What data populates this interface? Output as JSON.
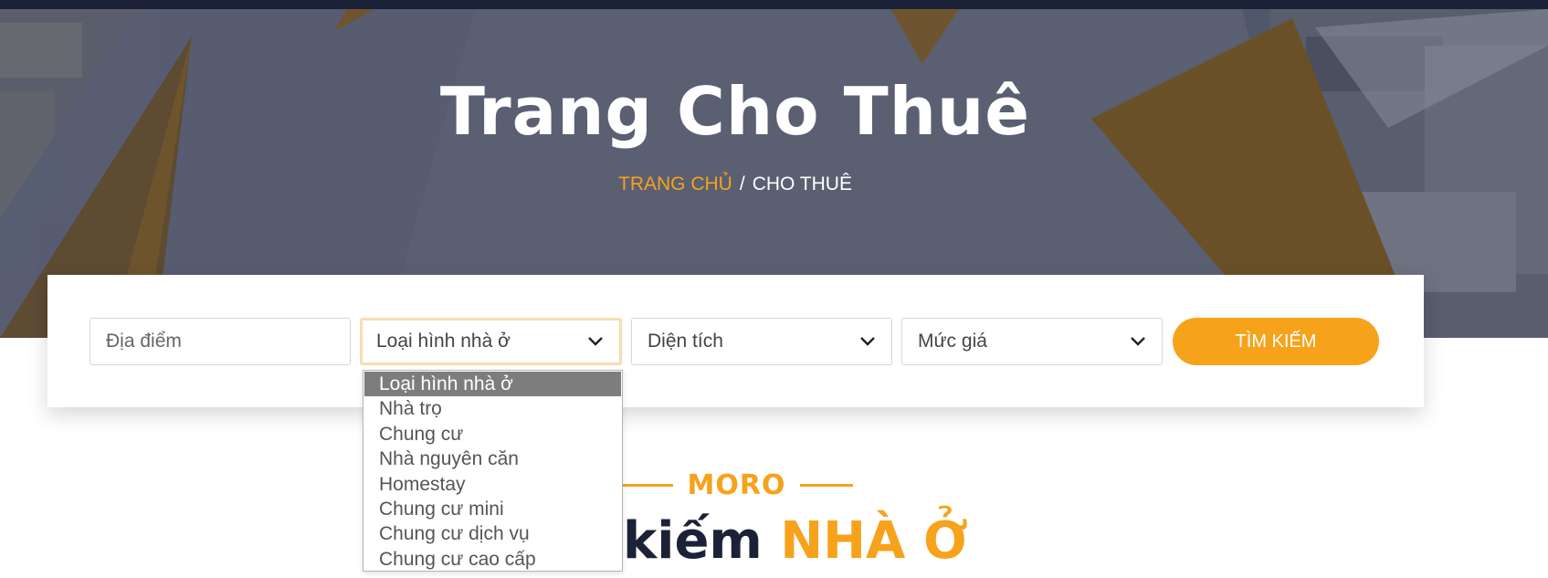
{
  "hero": {
    "title": "Trang Cho Thuê",
    "breadcrumb": {
      "home": "TRANG CHỦ",
      "separator": "/",
      "current": "CHO THUÊ"
    }
  },
  "search": {
    "location_placeholder": "Địa điểm",
    "type_select": {
      "value": "Loại hình nhà ở",
      "icon": "chevron-down-icon"
    },
    "area_select": {
      "value": "Diện tích",
      "icon": "chevron-down-icon"
    },
    "price_select": {
      "value": "Mức giá",
      "icon": "chevron-down-icon"
    },
    "button_label": "TÌM KIẾM"
  },
  "type_dropdown": {
    "options": [
      {
        "label": "Loại hình nhà ở",
        "selected": true
      },
      {
        "label": "Nhà trọ"
      },
      {
        "label": "Chung cư"
      },
      {
        "label": "Nhà nguyên căn"
      },
      {
        "label": "Homestay"
      },
      {
        "label": "Chung cư mini"
      },
      {
        "label": "Chung cư dịch vụ"
      },
      {
        "label": "Chung cư cao cấp"
      }
    ]
  },
  "section": {
    "tag": "MORO",
    "heading_prefix": "kiếm",
    "heading_accent": "NHÀ Ở"
  },
  "colors": {
    "accent": "#f7a21b",
    "navy": "#1b2237",
    "hero_overlay": "#5a5f72",
    "selected_option": "#7d7d7d"
  }
}
